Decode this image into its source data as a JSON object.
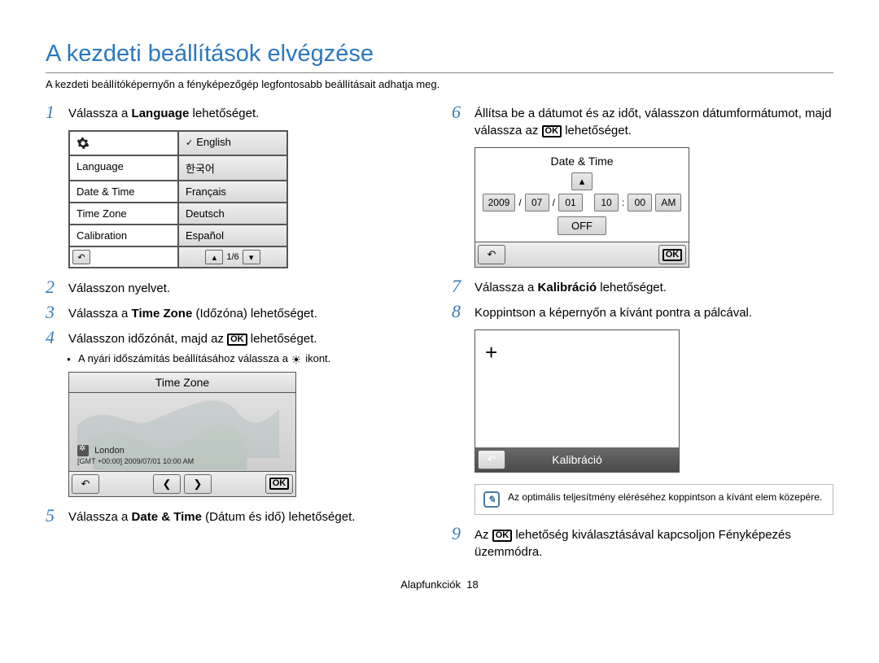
{
  "title": "A kezdeti beállítások elvégzése",
  "subtitle": "A kezdeti beállítóképernyőn a fényképezőgép legfontosabb beállításait adhatja meg.",
  "left": {
    "s1_pre": "Válassza a ",
    "s1_bold": "Language",
    "s1_post": " lehetőséget.",
    "lang_menu": {
      "items_left": [
        "Language",
        "Date & Time",
        "Time Zone",
        "Calibration"
      ],
      "items_right": [
        "English",
        "한국어",
        "Français",
        "Deutsch",
        "Español"
      ],
      "pager": "1/6"
    },
    "s2": "Válasszon nyelvet.",
    "s3_pre": "Válassza a ",
    "s3_bold": "Time Zone",
    "s3_post": " (Időzóna) lehetőséget.",
    "s4_pre": "Válasszon időzónát, majd az ",
    "s4_post": " lehetőséget.",
    "s4_note_pre": "A nyári időszámítás beállításához válassza a ",
    "s4_note_post": " ikont.",
    "tz": {
      "title": "Time Zone",
      "city": "London",
      "info": "[GMT +00:00] 2009/07/01 10:00 AM"
    },
    "s5_pre": "Válassza a ",
    "s5_bold": "Date & Time",
    "s5_post": " (Dátum és idő) lehetőséget."
  },
  "right": {
    "s6_pre": "Állítsa be a dátumot és az időt, válasszon dátumformátumot, majd válassza az ",
    "s6_post": " lehetőséget.",
    "dt": {
      "title": "Date & Time",
      "year": "2009",
      "mon": "07",
      "day": "01",
      "hour": "10",
      "min": "00",
      "ampm": "AM",
      "off": "OFF"
    },
    "s7_pre": "Válassza a ",
    "s7_bold": "Kalibráció",
    "s7_post": " lehetőséget.",
    "s8": "Koppintson a képernyőn a kívánt pontra a pálcával.",
    "cal_label": "Kalibráció",
    "note": "Az optimális teljesítmény eléréséhez koppintson a kívánt elem közepére.",
    "s9_pre": "Az ",
    "s9_post": " lehetőség kiválasztásával kapcsoljon Fényképezés üzemmódra."
  },
  "footer_label": "Alapfunkciók",
  "footer_page": "18"
}
